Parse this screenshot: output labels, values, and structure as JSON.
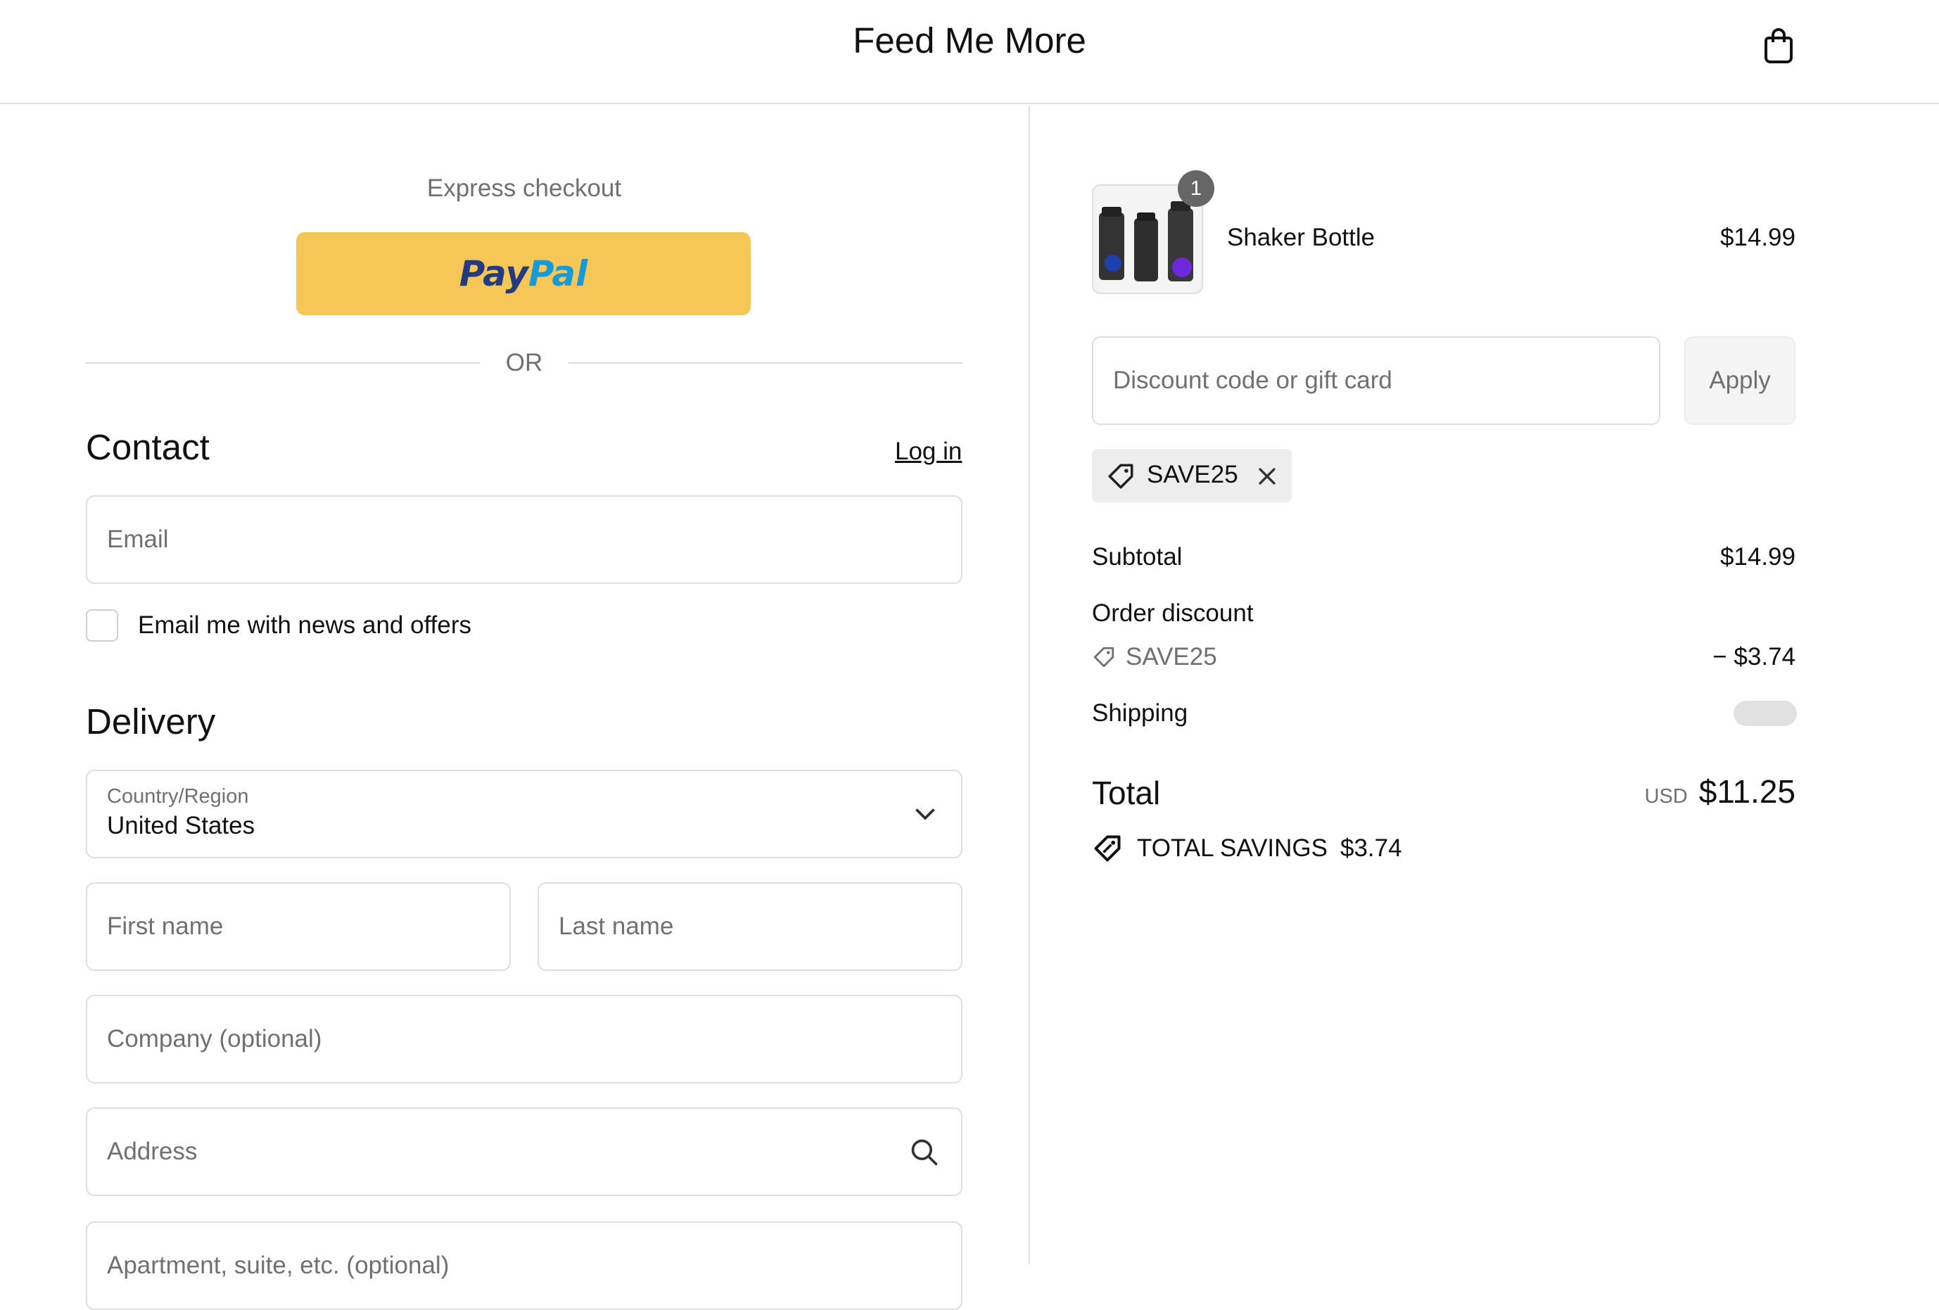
{
  "header": {
    "title": "Feed Me More",
    "cart_icon": "shopping-bag-icon"
  },
  "express": {
    "title": "Express checkout",
    "paypal_part1": "Pay",
    "paypal_part2": "Pal",
    "or_label": "OR"
  },
  "contact": {
    "title": "Contact",
    "login_label": "Log in",
    "email_placeholder": "Email",
    "news_label": "Email me with news and offers",
    "news_checked": false
  },
  "delivery": {
    "title": "Delivery",
    "country_label": "Country/Region",
    "country_value": "United States",
    "first_name_placeholder": "First name",
    "last_name_placeholder": "Last name",
    "company_placeholder": "Company (optional)",
    "address_placeholder": "Address",
    "apartment_placeholder": "Apartment, suite, etc. (optional)"
  },
  "order": {
    "item": {
      "name": "Shaker Bottle",
      "price": "$14.99",
      "quantity": "1"
    },
    "discount_placeholder": "Discount code or gift card",
    "apply_label": "Apply",
    "applied_code": "SAVE25",
    "subtotal_label": "Subtotal",
    "subtotal_value": "$14.99",
    "order_discount_label": "Order discount",
    "discount_code": "SAVE25",
    "discount_value": "− $3.74",
    "shipping_label": "Shipping",
    "total_label": "Total",
    "total_currency": "USD",
    "total_value": "$11.25",
    "savings_label": "TOTAL SAVINGS",
    "savings_value": "$3.74"
  },
  "colors": {
    "paypal_button": "#f6c757",
    "paypal_dark_blue": "#253b80",
    "paypal_light_blue": "#179bd7",
    "border": "#dedede",
    "muted_text": "#707070"
  }
}
